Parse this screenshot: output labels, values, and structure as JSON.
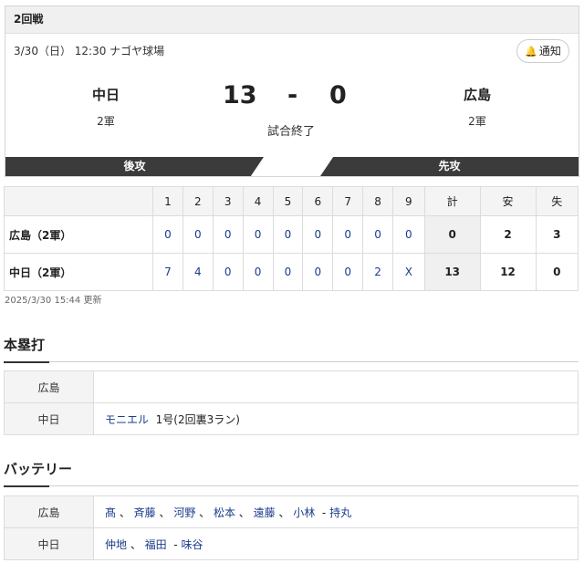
{
  "game": {
    "round": "2回戦",
    "date_venue": "3/30（日） 12:30 ナゴヤ球場",
    "notify_label": "通知",
    "home_team": "中日",
    "home_level": "2軍",
    "away_team": "広島",
    "away_level": "2軍",
    "home_score": "13",
    "away_score": "0",
    "dash": "-",
    "status": "試合終了",
    "home_band": "後攻",
    "away_band": "先攻"
  },
  "linescore": {
    "innings": [
      "1",
      "2",
      "3",
      "4",
      "5",
      "6",
      "7",
      "8",
      "9"
    ],
    "totals_headers": [
      "計",
      "安",
      "失"
    ],
    "rows": [
      {
        "team": "広島（2軍）",
        "innings": [
          "0",
          "0",
          "0",
          "0",
          "0",
          "0",
          "0",
          "0",
          "0"
        ],
        "r": "0",
        "h": "2",
        "e": "3"
      },
      {
        "team": "中日（2軍）",
        "innings": [
          "7",
          "4",
          "0",
          "0",
          "0",
          "0",
          "0",
          "2",
          "X"
        ],
        "r": "13",
        "h": "12",
        "e": "0"
      }
    ]
  },
  "updated": "2025/3/30 15:44 更新",
  "homeruns": {
    "title": "本塁打",
    "rows": [
      {
        "team": "広島",
        "value": ""
      },
      {
        "team": "中日",
        "player": "モニエル",
        "detail": "1号(2回裏3ラン)"
      }
    ]
  },
  "battery": {
    "title": "バッテリー",
    "rows": [
      {
        "team": "広島",
        "pitchers": [
          "髙",
          "斉藤",
          "河野",
          "松本",
          "遠藤",
          "小林"
        ],
        "catcher": "持丸"
      },
      {
        "team": "中日",
        "pitchers": [
          "仲地",
          "福田"
        ],
        "catcher": "味谷"
      }
    ]
  },
  "colors": {
    "band": "#3b3b3b",
    "link": "#1a3c8c"
  },
  "icons": {
    "notify": "bell-icon"
  }
}
